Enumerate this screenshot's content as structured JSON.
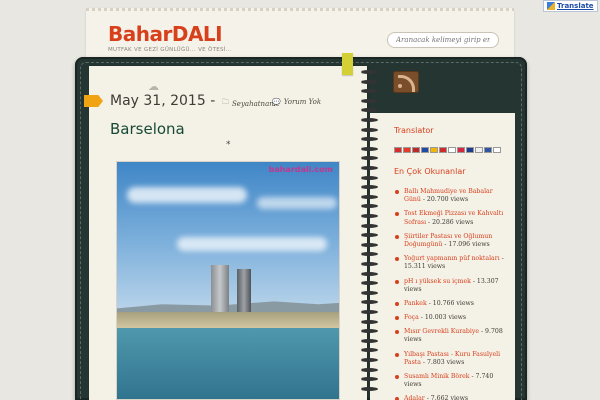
{
  "header": {
    "brand_title": "BaharDALI",
    "tagline": "MUTFAK VE GEZİ GÜNLÜĞÜ... VE ÖTESİ...",
    "search_placeholder": "Aranacak kelimeyi girip enter'a bas"
  },
  "translate": {
    "label": "Translate"
  },
  "post": {
    "date": "May 31, 2015 -",
    "category": "Seyahatname",
    "comments": "Yorum Yok",
    "title": "Barselona",
    "divider": "*",
    "photo_watermark": "bahardali.com"
  },
  "sidebar": {
    "translator_title": "Translator",
    "flag_colors": [
      "#d92c2c",
      "#e33a2a",
      "#c1262b",
      "#1f4aa5",
      "#f2b705",
      "#cc2b2b",
      "#ffffff",
      "#d7263d",
      "#1d3c8f",
      "#f0f0f0",
      "#3155a5",
      "#ffffff"
    ],
    "top_title": "En Çok Okunanlar",
    "top_posts": [
      {
        "title": "Ballı Mahmudiye ve Babalar Günü",
        "views": " - 20.700 views"
      },
      {
        "title": "Tost Ekmeği Pizzası ve Kahvaltı Sofrası",
        "views": " - 20.286 views"
      },
      {
        "title": "Şiirtiler Pastası ve Oğlumun Doğumgünü",
        "views": " - 17.096 views"
      },
      {
        "title": "Yoğurt yapmanın püf noktaları",
        "views": " - 15.311 views"
      },
      {
        "title": "pH ı yüksek su içmek",
        "views": " - 13.307 views"
      },
      {
        "title": "Pankek",
        "views": " - 10.766 views"
      },
      {
        "title": "Foça",
        "views": " - 10.003 views"
      },
      {
        "title": "Mısır Gevrekli Kurabiye",
        "views": " - 9.708 views"
      },
      {
        "title": "Yılbaşı Pastası - Kuru Fasulyeli Pasta",
        "views": " - 7.803 views"
      },
      {
        "title": "Susamlı Minik Börek",
        "views": " - 7.740 views"
      },
      {
        "title": "Adalar",
        "views": " - 7.662 views"
      }
    ]
  }
}
